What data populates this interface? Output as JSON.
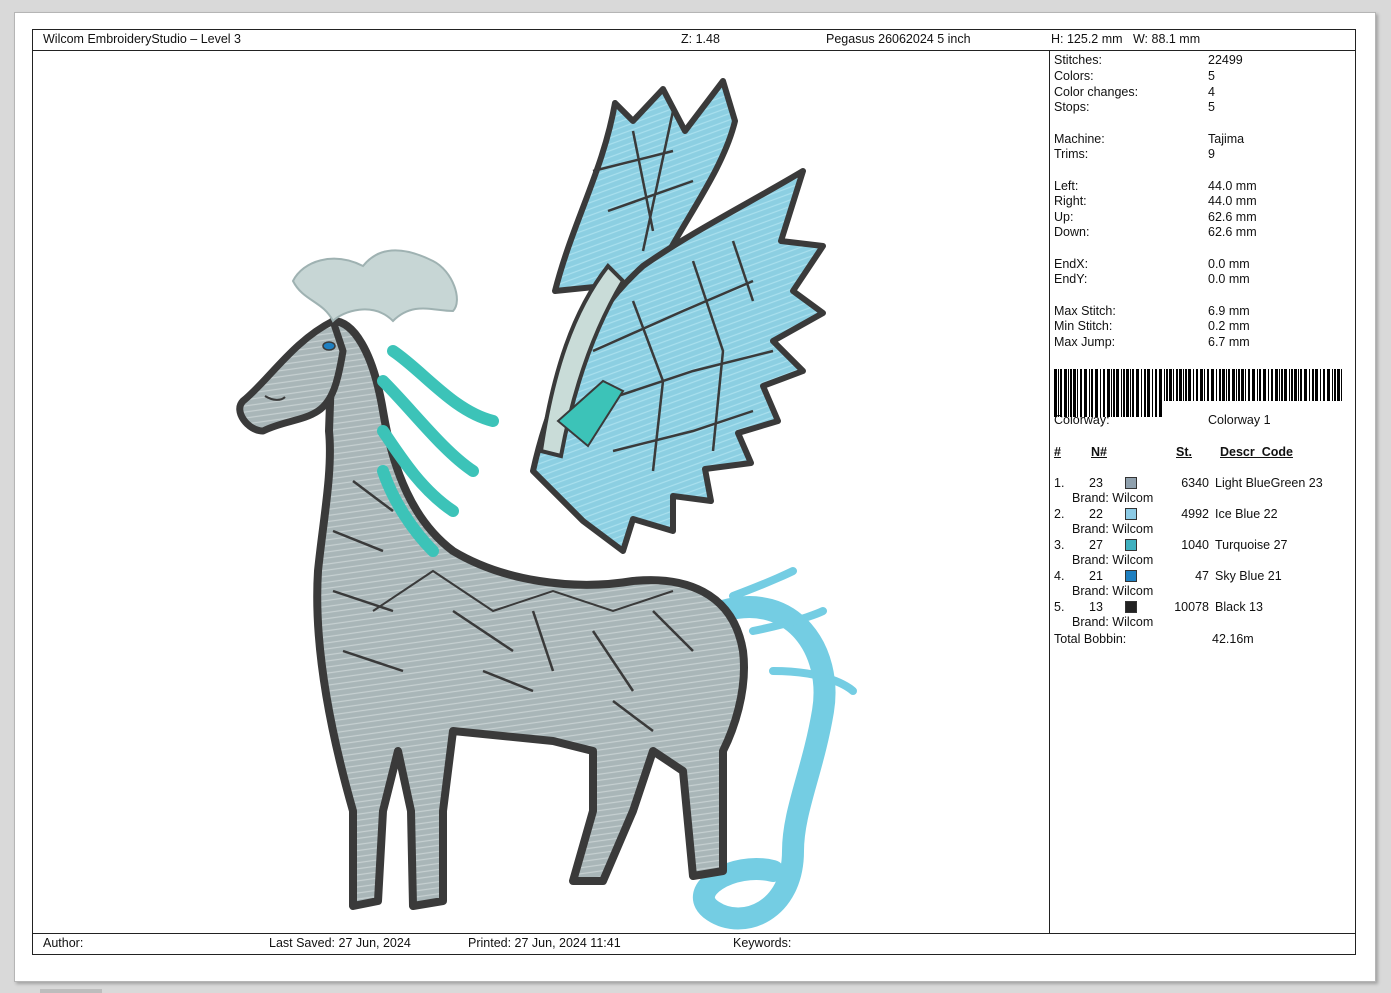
{
  "header": {
    "app_title": "Wilcom EmbroideryStudio – Level 3",
    "zoom": "Z: 1.48",
    "design_name": "Pegasus 26062024 5 inch",
    "size": "H: 125.2 mm   W: 88.1 mm"
  },
  "footer": {
    "author": "Author:",
    "last_saved": "Last Saved: 27 Jun, 2024",
    "printed": "Printed: 27 Jun, 2024 11:41",
    "keywords": "Keywords:"
  },
  "stats": {
    "stitches_label": "Stitches:",
    "stitches": "22499",
    "colors_label": "Colors:",
    "colors": "5",
    "color_changes_label": "Color changes:",
    "color_changes": "4",
    "stops_label": "Stops:",
    "stops": "5",
    "machine_label": "Machine:",
    "machine": "Tajima",
    "trims_label": "Trims:",
    "trims": "9",
    "left_label": "Left:",
    "left": "44.0 mm",
    "right_label": "Right:",
    "right": "44.0 mm",
    "up_label": "Up:",
    "up": "62.6 mm",
    "down_label": "Down:",
    "down": "62.6 mm",
    "endx_label": "EndX:",
    "endx": "0.0 mm",
    "endy_label": "EndY:",
    "endy": "0.0 mm",
    "max_stitch_label": "Max Stitch:",
    "max_stitch": "6.9 mm",
    "min_stitch_label": "Min Stitch:",
    "min_stitch": "0.2 mm",
    "max_jump_label": "Max Jump:",
    "max_jump": "6.7 mm",
    "colorway_label": "Colorway:",
    "colorway": "Colorway 1"
  },
  "color_table": {
    "headers": {
      "index": "#",
      "needle": "N#",
      "stitches": "St.",
      "descr": "Descr_Code"
    },
    "rows": [
      {
        "idx": "1.",
        "needle": "23",
        "color": "#8fa0ad",
        "stitches": "6340",
        "descr": "Light BlueGreen 23",
        "brand": "Brand: Wilcom"
      },
      {
        "idx": "2.",
        "needle": "22",
        "color": "#8ccbe6",
        "stitches": "4992",
        "descr": "Ice Blue 22",
        "brand": "Brand: Wilcom"
      },
      {
        "idx": "3.",
        "needle": "27",
        "color": "#3fb0bf",
        "stitches": "1040",
        "descr": "Turquoise 27",
        "brand": "Brand: Wilcom"
      },
      {
        "idx": "4.",
        "needle": "21",
        "color": "#1e7fc0",
        "stitches": "47",
        "descr": "Sky Blue 21",
        "brand": "Brand: Wilcom"
      },
      {
        "idx": "5.",
        "needle": "13",
        "color": "#222222",
        "stitches": "10078",
        "descr": "Black 13",
        "brand": "Brand: Wilcom"
      }
    ],
    "total_bobbin_label": "Total Bobbin:",
    "total_bobbin": "42.16m"
  },
  "colors": {
    "outline": "#3a3a3a",
    "body": "#a8b4b6",
    "wing": "#8ed3e6",
    "mane": "#c9d9d8",
    "turquoise": "#3cc3b8",
    "tail": "#7fd3e6",
    "eye": "#1e7fc0"
  }
}
